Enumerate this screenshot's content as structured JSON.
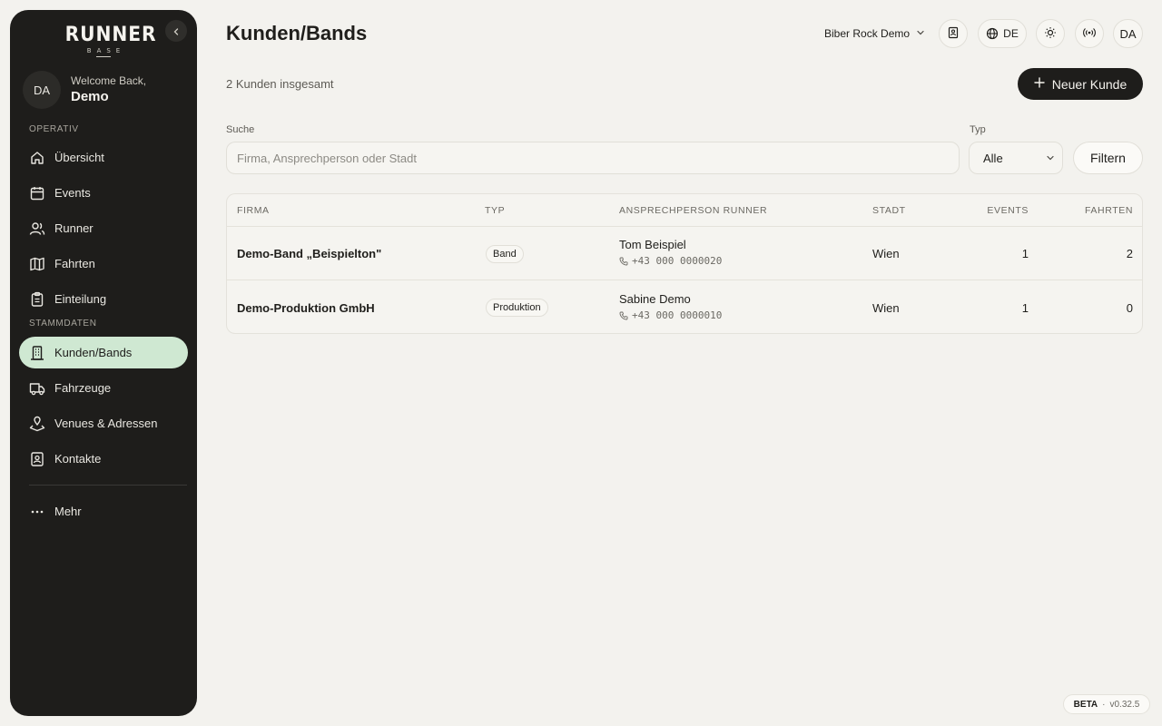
{
  "sidebar": {
    "logo_main": "RUNNER",
    "logo_sub": "BASE",
    "user_initials": "DA",
    "welcome": "Welcome Back,",
    "user_name": "Demo",
    "section_operativ": "OPERATIV",
    "section_stammdaten": "STAMMDATEN",
    "items": [
      {
        "label": "Übersicht",
        "icon": "home-icon"
      },
      {
        "label": "Events",
        "icon": "calendar-icon"
      },
      {
        "label": "Runner",
        "icon": "users-icon"
      },
      {
        "label": "Fahrten",
        "icon": "map-icon"
      },
      {
        "label": "Einteilung",
        "icon": "clipboard-icon"
      },
      {
        "label": "Kunden/Bands",
        "icon": "building-icon",
        "active": true
      },
      {
        "label": "Fahrzeuge",
        "icon": "truck-icon"
      },
      {
        "label": "Venues & Adressen",
        "icon": "location-icon"
      },
      {
        "label": "Kontakte",
        "icon": "contact-icon"
      },
      {
        "label": "Mehr",
        "icon": "more-icon"
      }
    ]
  },
  "header": {
    "title": "Kunden/Bands",
    "org": "Biber Rock Demo",
    "language": "DE",
    "user_initials": "DA"
  },
  "main": {
    "count_text": "2 Kunden insgesamt",
    "new_button": "Neuer Kunde",
    "search_label": "Suche",
    "search_placeholder": "Firma, Ansprechperson oder Stadt",
    "search_value": "",
    "type_label": "Typ",
    "type_value": "Alle",
    "filter_button": "Filtern"
  },
  "table": {
    "headers": [
      "FIRMA",
      "TYP",
      "ANSPRECHPERSON RUNNER",
      "STADT",
      "EVENTS",
      "FAHRTEN"
    ],
    "rows": [
      {
        "firma": "Demo-Band „Beispielton\"",
        "typ": "Band",
        "contact": "Tom Beispiel",
        "phone": "+43 000 0000020",
        "stadt": "Wien",
        "events": "1",
        "fahrten": "2"
      },
      {
        "firma": "Demo-Produktion GmbH",
        "typ": "Produktion",
        "contact": "Sabine Demo",
        "phone": "+43 000 0000010",
        "stadt": "Wien",
        "events": "1",
        "fahrten": "0"
      }
    ]
  },
  "footer": {
    "beta": "BETA",
    "separator": "·",
    "version": "v0.32.5"
  }
}
